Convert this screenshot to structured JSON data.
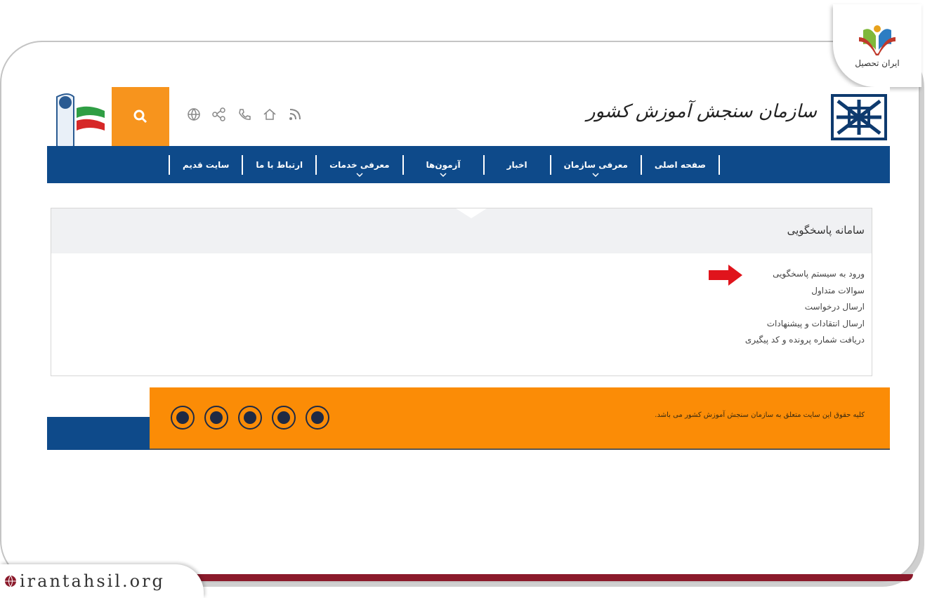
{
  "brand": {
    "badge_text": "ایران تحصیل",
    "watermark": "irantahsil.org"
  },
  "site": {
    "org_name": "سازمان سنجش آموزش کشور"
  },
  "nav": {
    "items": [
      {
        "label": "صفحه اصلی",
        "has_dropdown": false
      },
      {
        "label": "معرفی سازمان",
        "has_dropdown": true
      },
      {
        "label": "اخبار",
        "has_dropdown": false
      },
      {
        "label": "آزمون‌ها",
        "has_dropdown": true
      },
      {
        "label": "معرفی خدمات",
        "has_dropdown": true
      },
      {
        "label": "ارتباط با ما",
        "has_dropdown": false
      },
      {
        "label": "سایت قدیم",
        "has_dropdown": false
      }
    ]
  },
  "quick_icons": [
    "rss-icon",
    "home-icon",
    "phone-icon",
    "share-icon",
    "globe-icon"
  ],
  "panel": {
    "title": "سامانه پاسخگویی",
    "links": [
      "ورود به سیستم پاسخگویی",
      "سوالات متداول",
      "ارسال درخواست",
      "ارسال انتقادات و پیشنهادات",
      "دریافت شماره پرونده و کد پیگیری"
    ]
  },
  "footer": {
    "copyright": "کلیه حقوق این سایت متعلق به سازمان سنجش آموزش کشور می باشد.",
    "social_icons": [
      "aparat-icon",
      "instagram-icon",
      "telegram-icon",
      "bale-icon",
      "rubika-icon"
    ]
  },
  "colors": {
    "nav_blue": "#0e4a8a",
    "accent_orange": "#f7941d",
    "footer_orange": "#fb8c06",
    "arrow_red": "#e0141c",
    "frame_red": "#8b1a2b"
  }
}
